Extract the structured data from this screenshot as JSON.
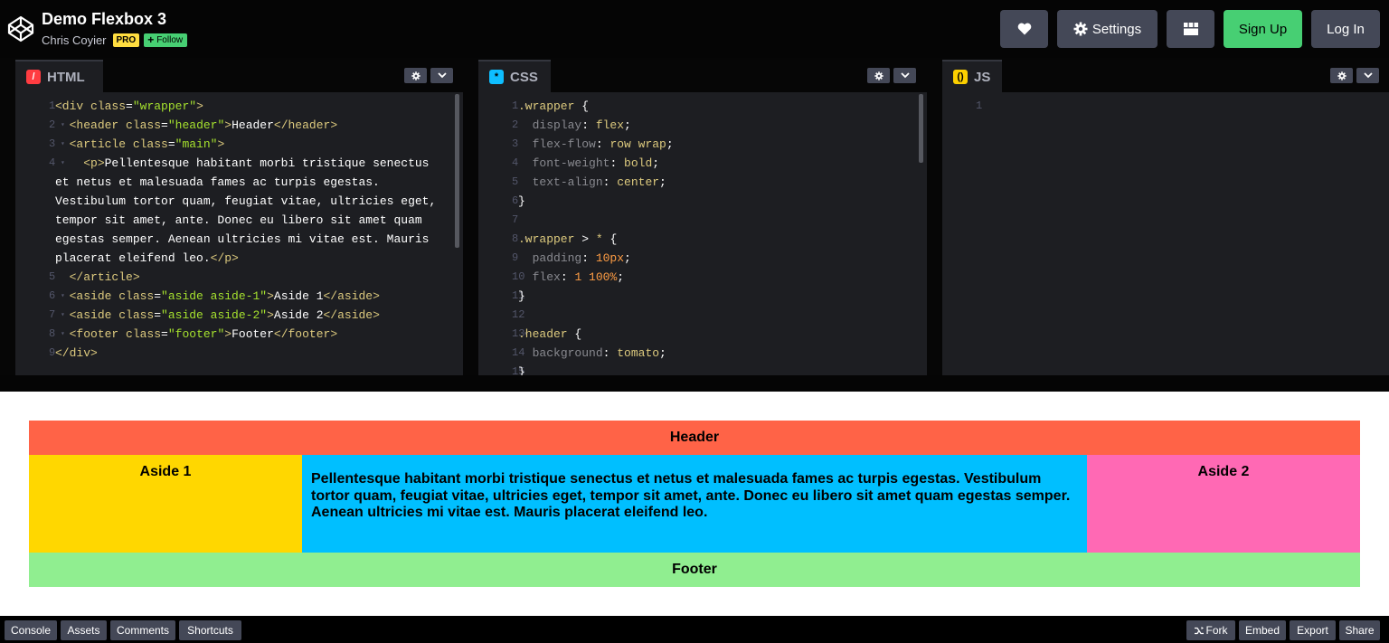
{
  "pen": {
    "title": "Demo Flexbox 3",
    "author": "Chris Coyier",
    "pro_badge": "PRO",
    "follow_label": "Follow"
  },
  "header_buttons": {
    "settings": "Settings",
    "signup": "Sign Up",
    "login": "Log In"
  },
  "editors": {
    "html": {
      "label": "HTML",
      "lines": [
        {
          "n": "1",
          "fold": "▾",
          "parts": [
            [
              "t-tag",
              "<div "
            ],
            [
              "t-attr",
              "class"
            ],
            [
              "t-punc",
              "="
            ],
            [
              "t-str",
              "\"wrapper\""
            ],
            [
              "t-tag",
              ">"
            ]
          ]
        },
        {
          "n": "2",
          "fold": "▾",
          "parts": [
            [
              "t-txt",
              "  "
            ],
            [
              "t-tag",
              "<header "
            ],
            [
              "t-attr",
              "class"
            ],
            [
              "t-punc",
              "="
            ],
            [
              "t-str",
              "\"header\""
            ],
            [
              "t-tag",
              ">"
            ],
            [
              "t-txt",
              "Header"
            ],
            [
              "t-tag",
              "</header>"
            ]
          ]
        },
        {
          "n": "3",
          "fold": "▾",
          "parts": [
            [
              "t-txt",
              "  "
            ],
            [
              "t-tag",
              "<article "
            ],
            [
              "t-attr",
              "class"
            ],
            [
              "t-punc",
              "="
            ],
            [
              "t-str",
              "\"main\""
            ],
            [
              "t-tag",
              ">"
            ]
          ]
        },
        {
          "n": "4",
          "fold": "▾",
          "parts": [
            [
              "t-txt",
              "    "
            ],
            [
              "t-tag",
              "<p>"
            ],
            [
              "t-txt",
              "Pellentesque habitant morbi tristique senectus"
            ]
          ]
        },
        {
          "n": "",
          "fold": "",
          "parts": [
            [
              "t-txt",
              "et netus et malesuada fames ac turpis egestas."
            ]
          ]
        },
        {
          "n": "",
          "fold": "",
          "parts": [
            [
              "t-txt",
              "Vestibulum tortor quam, feugiat vitae, ultricies eget,"
            ]
          ]
        },
        {
          "n": "",
          "fold": "",
          "parts": [
            [
              "t-txt",
              "tempor sit amet, ante. Donec eu libero sit amet quam"
            ]
          ]
        },
        {
          "n": "",
          "fold": "",
          "parts": [
            [
              "t-txt",
              "egestas semper. Aenean ultricies mi vitae est. Mauris"
            ]
          ]
        },
        {
          "n": "",
          "fold": "",
          "parts": [
            [
              "t-txt",
              "placerat eleifend leo."
            ],
            [
              "t-tag",
              "</p>"
            ]
          ]
        },
        {
          "n": "5",
          "fold": "",
          "parts": [
            [
              "t-txt",
              "  "
            ],
            [
              "t-tag",
              "</article>"
            ]
          ]
        },
        {
          "n": "6",
          "fold": "▾",
          "parts": [
            [
              "t-txt",
              "  "
            ],
            [
              "t-tag",
              "<aside "
            ],
            [
              "t-attr",
              "class"
            ],
            [
              "t-punc",
              "="
            ],
            [
              "t-str",
              "\"aside aside-1\""
            ],
            [
              "t-tag",
              ">"
            ],
            [
              "t-txt",
              "Aside 1"
            ],
            [
              "t-tag",
              "</aside>"
            ]
          ]
        },
        {
          "n": "7",
          "fold": "▾",
          "parts": [
            [
              "t-txt",
              "  "
            ],
            [
              "t-tag",
              "<aside "
            ],
            [
              "t-attr",
              "class"
            ],
            [
              "t-punc",
              "="
            ],
            [
              "t-str",
              "\"aside aside-2\""
            ],
            [
              "t-tag",
              ">"
            ],
            [
              "t-txt",
              "Aside 2"
            ],
            [
              "t-tag",
              "</aside>"
            ]
          ]
        },
        {
          "n": "8",
          "fold": "▾",
          "parts": [
            [
              "t-txt",
              "  "
            ],
            [
              "t-tag",
              "<footer "
            ],
            [
              "t-attr",
              "class"
            ],
            [
              "t-punc",
              "="
            ],
            [
              "t-str",
              "\"footer\""
            ],
            [
              "t-tag",
              ">"
            ],
            [
              "t-txt",
              "Footer"
            ],
            [
              "t-tag",
              "</footer>"
            ]
          ]
        },
        {
          "n": "9",
          "fold": "",
          "parts": [
            [
              "t-tag",
              "</div>"
            ]
          ]
        }
      ]
    },
    "css": {
      "label": "CSS",
      "lines": [
        {
          "n": "1",
          "fold": "▾",
          "parts": [
            [
              "t-sel",
              ".wrapper"
            ],
            [
              "t-punc",
              " {"
            ]
          ]
        },
        {
          "n": "2",
          "fold": "",
          "parts": [
            [
              "t-txt",
              "  "
            ],
            [
              "t-prop",
              "display"
            ],
            [
              "t-punc",
              ": "
            ],
            [
              "t-val",
              "flex"
            ],
            [
              "t-punc",
              ";"
            ]
          ]
        },
        {
          "n": "3",
          "fold": "",
          "parts": [
            [
              "t-txt",
              "  "
            ],
            [
              "t-prop",
              "flex-flow"
            ],
            [
              "t-punc",
              ": "
            ],
            [
              "t-val",
              "row wrap"
            ],
            [
              "t-punc",
              ";"
            ]
          ]
        },
        {
          "n": "4",
          "fold": "",
          "parts": [
            [
              "t-txt",
              "  "
            ],
            [
              "t-prop",
              "font-weight"
            ],
            [
              "t-punc",
              ": "
            ],
            [
              "t-val",
              "bold"
            ],
            [
              "t-punc",
              ";"
            ]
          ]
        },
        {
          "n": "5",
          "fold": "",
          "parts": [
            [
              "t-txt",
              "  "
            ],
            [
              "t-prop",
              "text-align"
            ],
            [
              "t-punc",
              ": "
            ],
            [
              "t-val",
              "center"
            ],
            [
              "t-punc",
              ";"
            ]
          ]
        },
        {
          "n": "6",
          "fold": "",
          "parts": [
            [
              "t-punc",
              "}"
            ]
          ]
        },
        {
          "n": "7",
          "fold": "",
          "parts": []
        },
        {
          "n": "8",
          "fold": "▾",
          "parts": [
            [
              "t-sel",
              ".wrapper"
            ],
            [
              "t-punc",
              " > "
            ],
            [
              "t-sel",
              "*"
            ],
            [
              "t-punc",
              " {"
            ]
          ]
        },
        {
          "n": "9",
          "fold": "",
          "parts": [
            [
              "t-txt",
              "  "
            ],
            [
              "t-prop",
              "padding"
            ],
            [
              "t-punc",
              ": "
            ],
            [
              "t-num",
              "10px"
            ],
            [
              "t-punc",
              ";"
            ]
          ]
        },
        {
          "n": "10",
          "fold": "",
          "parts": [
            [
              "t-txt",
              "  "
            ],
            [
              "t-prop",
              "flex"
            ],
            [
              "t-punc",
              ": "
            ],
            [
              "t-num",
              "1 100%"
            ],
            [
              "t-punc",
              ";"
            ]
          ]
        },
        {
          "n": "11",
          "fold": "",
          "parts": [
            [
              "t-punc",
              "}"
            ]
          ]
        },
        {
          "n": "12",
          "fold": "",
          "parts": []
        },
        {
          "n": "13",
          "fold": "▾",
          "parts": [
            [
              "t-sel",
              ".header"
            ],
            [
              "t-punc",
              " {"
            ]
          ]
        },
        {
          "n": "14",
          "fold": "",
          "parts": [
            [
              "t-txt",
              "  "
            ],
            [
              "t-prop",
              "background"
            ],
            [
              "t-punc",
              ": "
            ],
            [
              "t-val",
              "tomato"
            ],
            [
              "t-punc",
              ";"
            ]
          ]
        },
        {
          "n": "15",
          "fold": "",
          "parts": [
            [
              "t-punc",
              "}"
            ]
          ]
        }
      ]
    },
    "js": {
      "label": "JS",
      "lines": [
        {
          "n": "1",
          "fold": "",
          "parts": []
        }
      ]
    }
  },
  "preview": {
    "header": "Header",
    "aside1": "Aside 1",
    "main": "Pellentesque habitant morbi tristique senectus et netus et malesuada fames ac turpis egestas. Vestibulum tortor quam, feugiat vitae, ultricies eget, tempor sit amet, ante. Donec eu libero sit amet quam egestas semper. Aenean ultricies mi vitae est. Mauris placerat eleifend leo.",
    "aside2": "Aside 2",
    "footer": "Footer"
  },
  "bottom_bar": {
    "console": "Console",
    "assets": "Assets",
    "comments": "Comments",
    "shortcuts": "Shortcuts",
    "fork": "Fork",
    "embed": "Embed",
    "export": "Export",
    "share": "Share"
  },
  "colors": {
    "html_icon": "#ff3c41",
    "css_icon": "#0ebeff",
    "js_icon": "#fcd000",
    "accent_green": "#47cf73"
  }
}
